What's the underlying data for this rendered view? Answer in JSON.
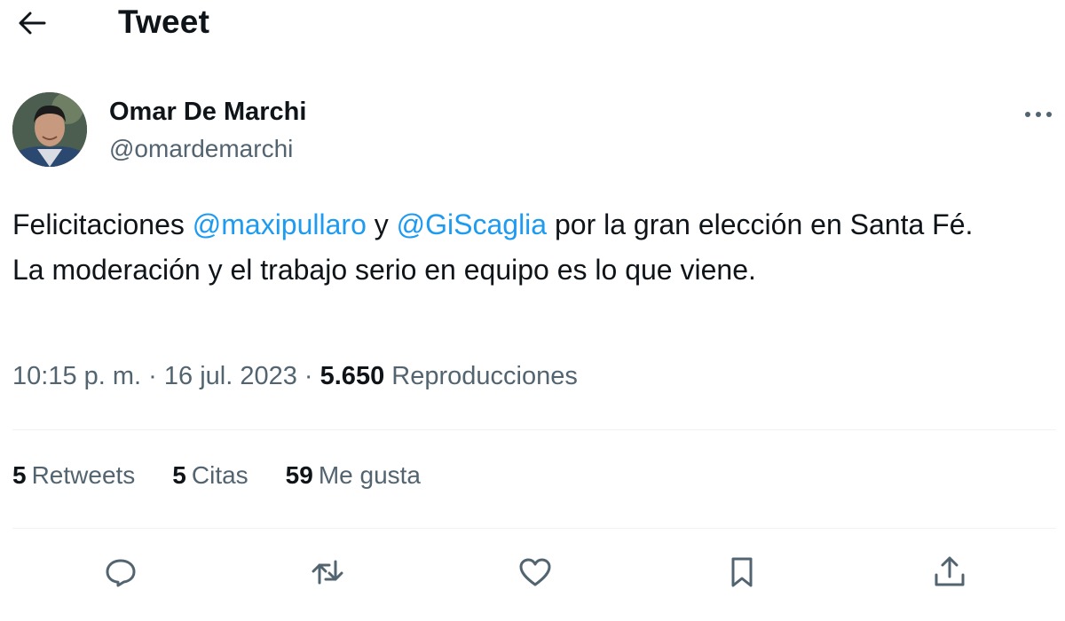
{
  "header": {
    "title": "Tweet",
    "back_icon": "arrow-left-icon"
  },
  "author": {
    "name": "Omar De Marchi",
    "handle": "@omardemarchi",
    "more_icon": "more-horizontal-icon"
  },
  "tweet": {
    "line1": {
      "before": "Felicitaciones ",
      "mention1": "@maxipullaro",
      "middle": " y ",
      "mention2": "@GiScaglia",
      "after": " por la gran elección en Santa Fé."
    },
    "line2": "La moderación y el trabajo serio en equipo es lo que viene."
  },
  "meta": {
    "time": "10:15 p. m.",
    "separator": " · ",
    "date": "16 jul. 2023",
    "views_count": "5.650",
    "views_label": "Reproducciones"
  },
  "stats": {
    "retweets_count": "5",
    "retweets_label": "Retweets",
    "quotes_count": "5",
    "quotes_label": "Citas",
    "likes_count": "59",
    "likes_label": "Me gusta"
  },
  "actions": [
    "reply-icon",
    "retweet-icon",
    "like-icon",
    "bookmark-icon",
    "share-icon"
  ],
  "colors": {
    "link": "#1d9bf0",
    "text": "#0f1419",
    "secondary": "#536471",
    "divider": "#eff3f4"
  }
}
